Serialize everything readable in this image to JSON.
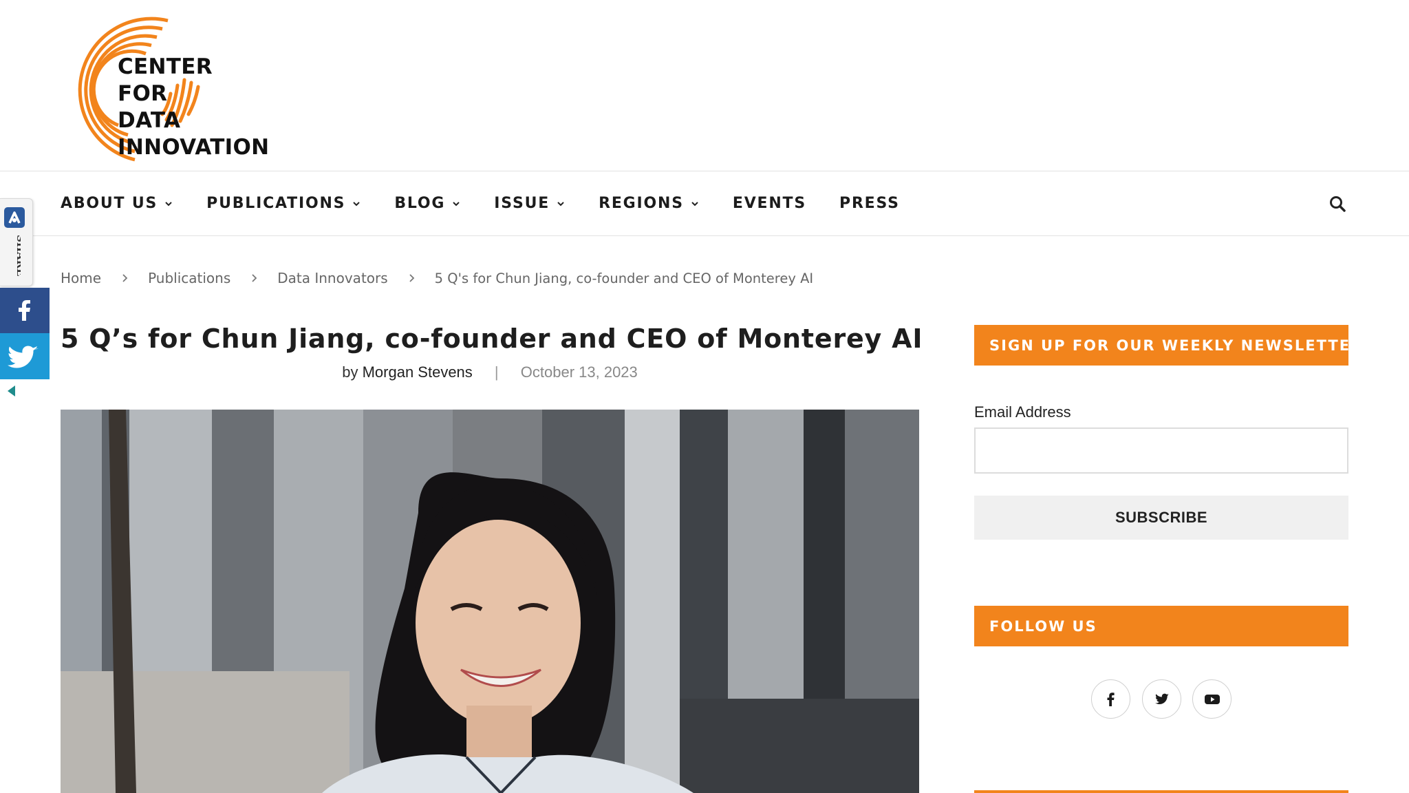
{
  "site": {
    "logo_lines": [
      "CENTER",
      "FOR",
      "DATA",
      "INNOVATION"
    ],
    "brand_color": "#f2841c"
  },
  "nav": {
    "items": [
      {
        "label": "ABOUT US",
        "has_dropdown": true
      },
      {
        "label": "PUBLICATIONS",
        "has_dropdown": true
      },
      {
        "label": "BLOG",
        "has_dropdown": true
      },
      {
        "label": "ISSUE",
        "has_dropdown": true
      },
      {
        "label": "REGIONS",
        "has_dropdown": true
      },
      {
        "label": "EVENTS",
        "has_dropdown": false
      },
      {
        "label": "PRESS",
        "has_dropdown": false
      }
    ],
    "search_icon": "search-icon"
  },
  "share_bar": {
    "label": "SHARE",
    "facebook_color": "#2d4e8c",
    "twitter_color": "#1e9ad6"
  },
  "breadcrumb": {
    "items": [
      "Home",
      "Publications",
      "Data Innovators"
    ],
    "current": "5 Q's for Chun Jiang, co-founder and CEO of Monterey AI"
  },
  "article": {
    "title": "5 Q’s for Chun Jiang, co-founder and CEO of Monterey AI",
    "by": "by",
    "author": "Morgan Stevens",
    "divider": "|",
    "date": "October 13, 2023"
  },
  "sidebar": {
    "newsletter_heading": "SIGN UP FOR OUR WEEKLY NEWSLETTER",
    "email_label": "Email Address",
    "email_value": "",
    "subscribe_label": "SUBSCRIBE",
    "follow_heading": "FOLLOW US",
    "socials": [
      "facebook-icon",
      "twitter-icon",
      "youtube-icon"
    ]
  }
}
